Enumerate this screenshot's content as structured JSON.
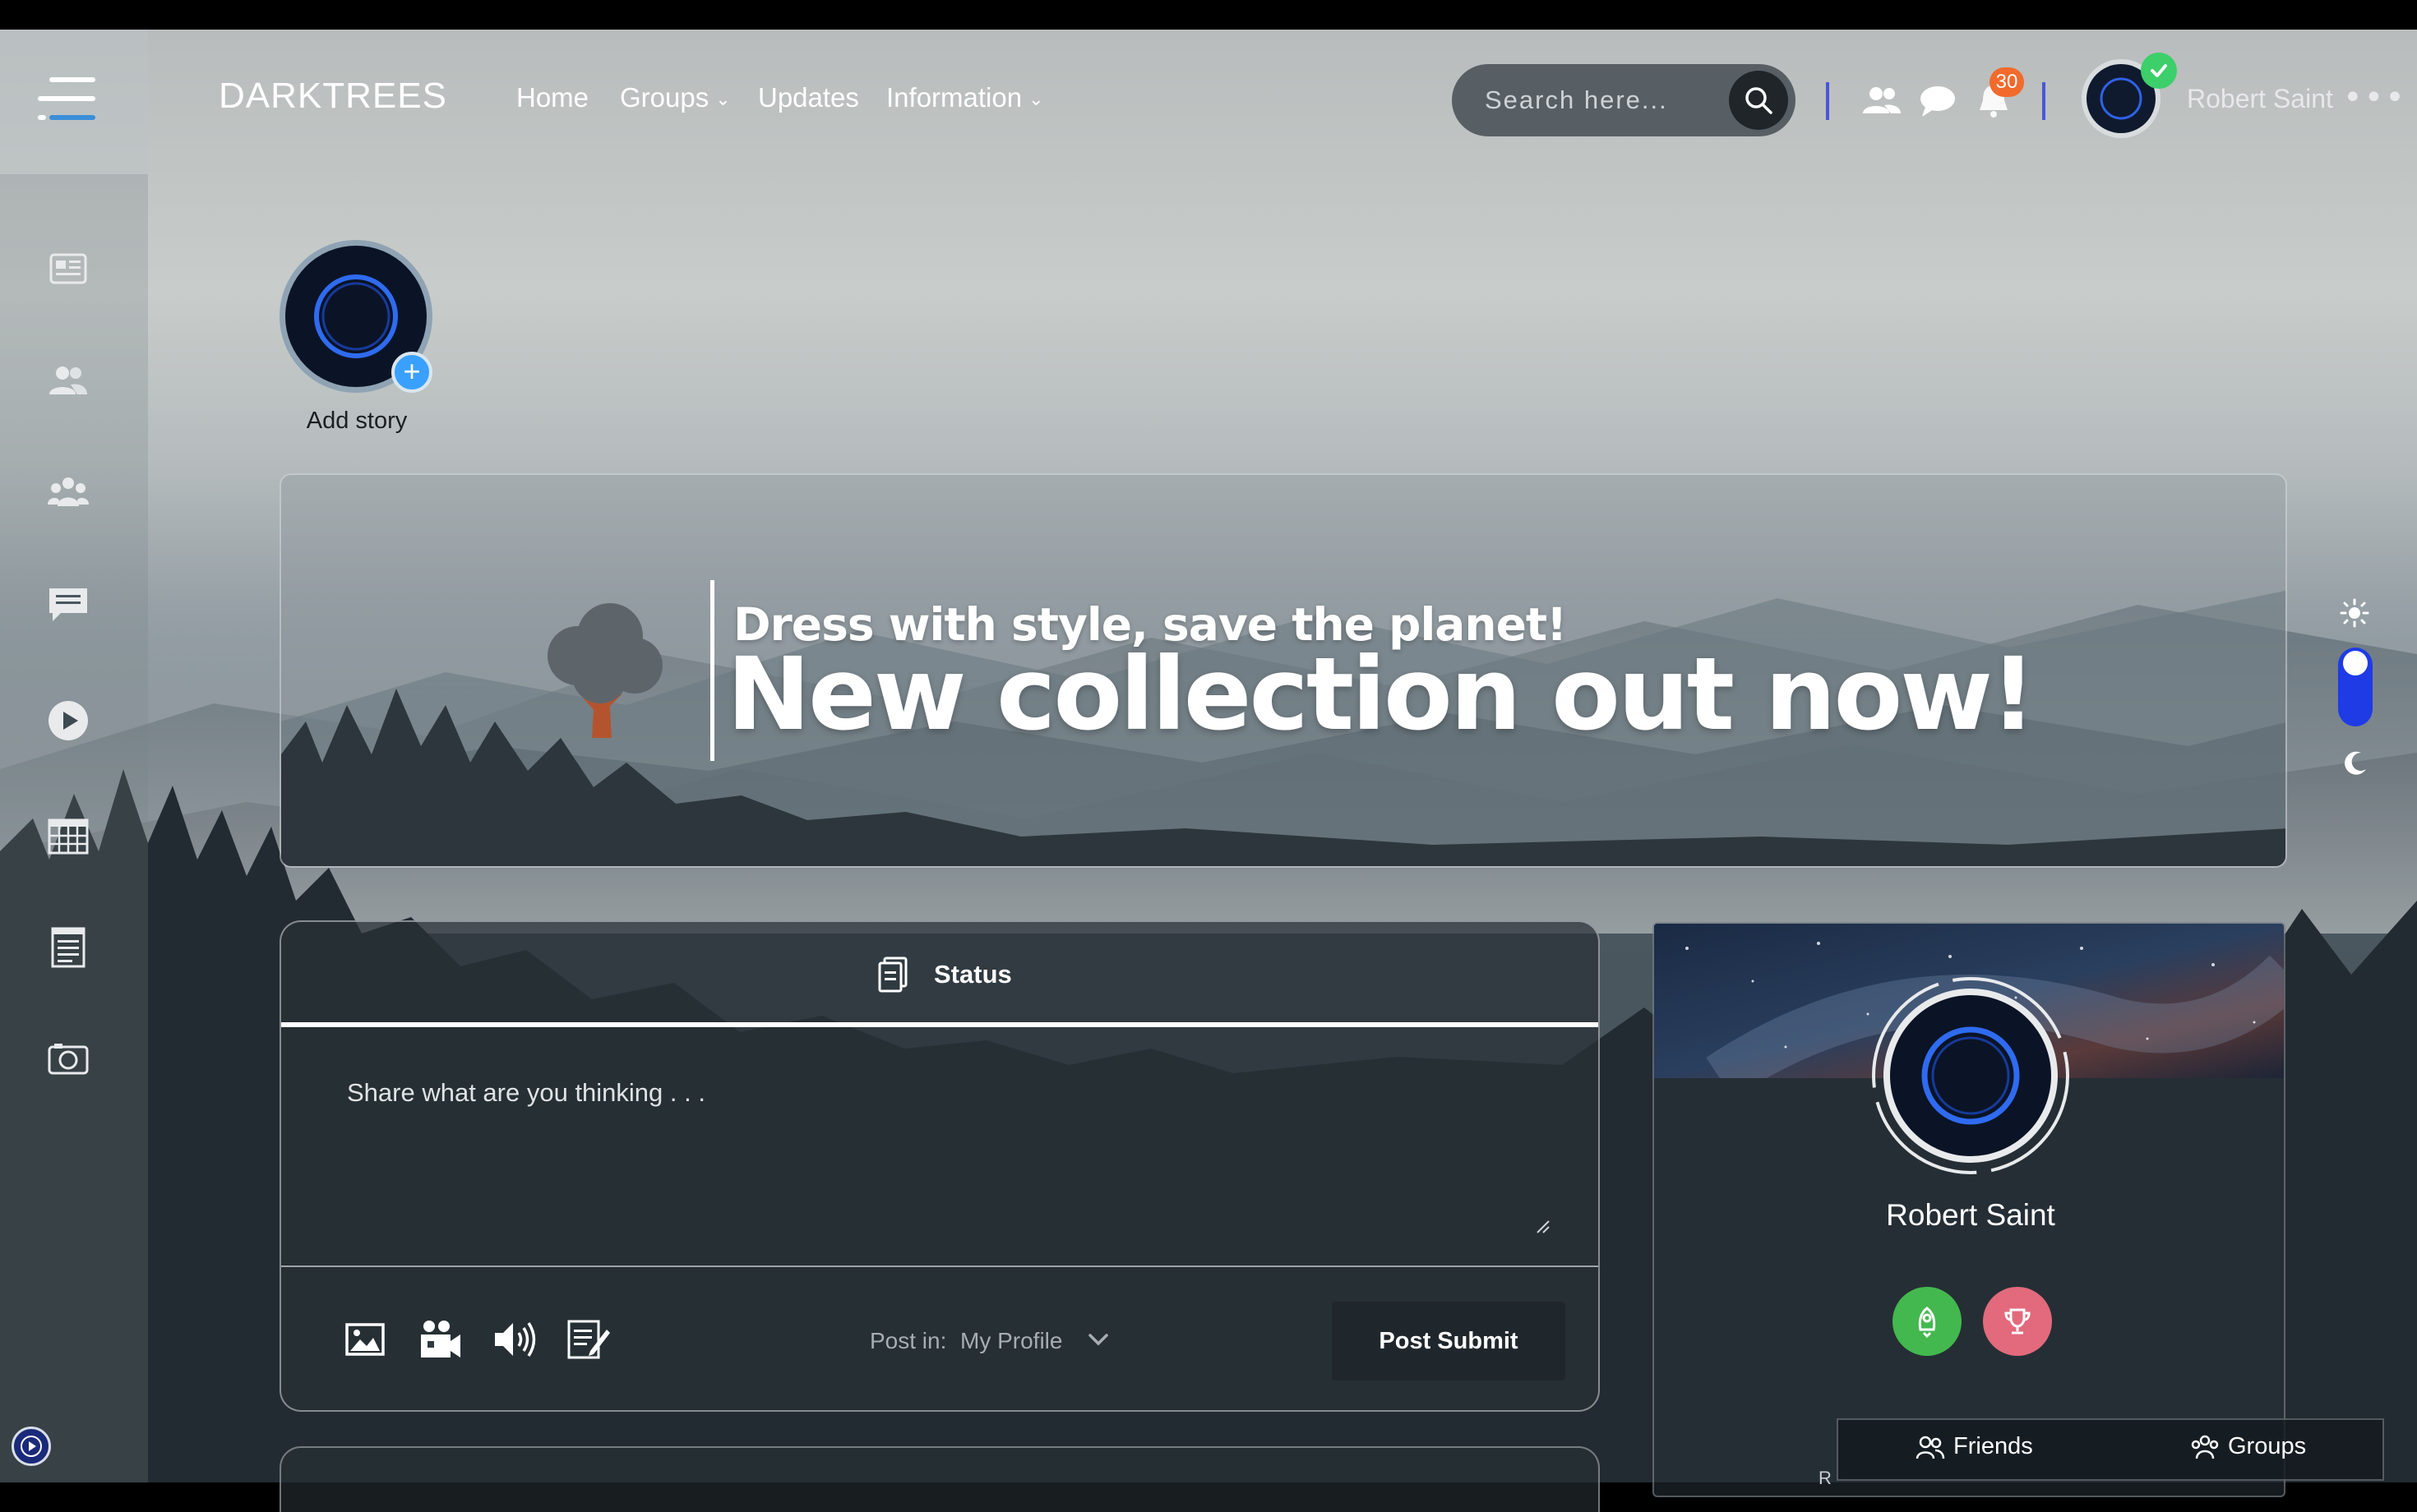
{
  "app": {
    "brand": "DARKTREES"
  },
  "nav": {
    "items": [
      {
        "label": "Home",
        "has_dropdown": false
      },
      {
        "label": "Groups",
        "has_dropdown": true
      },
      {
        "label": "Updates",
        "has_dropdown": false
      },
      {
        "label": "Information",
        "has_dropdown": true
      }
    ]
  },
  "search": {
    "placeholder": "Search here..."
  },
  "header": {
    "notification_count": "30",
    "user_name": "Robert Saint",
    "more_glyph": "•••",
    "icons": [
      "friends-icon",
      "chat-icon",
      "bell-icon"
    ]
  },
  "sidebar": {
    "icons": [
      "newsfeed-icon",
      "friends-icon",
      "groups-icon",
      "messages-icon",
      "video-icon",
      "calendar-icon",
      "notes-icon",
      "photos-icon"
    ]
  },
  "story": {
    "label": "Add story",
    "plus": "+"
  },
  "banner": {
    "subtitle": "Dress with style, save the planet!",
    "title": "New collection out now!"
  },
  "status": {
    "tab_label": "Status",
    "placeholder": "Share what are you thinking . . .",
    "post_in_label": "Post in:",
    "post_in_value": "My Profile",
    "submit_label": "Post Submit",
    "tools": [
      "image-icon",
      "video-camera-icon",
      "audio-icon",
      "note-icon"
    ]
  },
  "profile": {
    "name": "Robert Saint",
    "badges": [
      {
        "icon": "rocket-icon",
        "color": "#43b84e"
      },
      {
        "icon": "trophy-icon",
        "color": "#e26a7c"
      }
    ],
    "tabs": [
      {
        "label": "Friends"
      },
      {
        "label": "Groups"
      }
    ],
    "partial_text": "R"
  },
  "colors": {
    "accent": "#1e3be6",
    "divider": "#4a56d8",
    "badge": "#f26a2c",
    "online": "#3ccf6a"
  }
}
